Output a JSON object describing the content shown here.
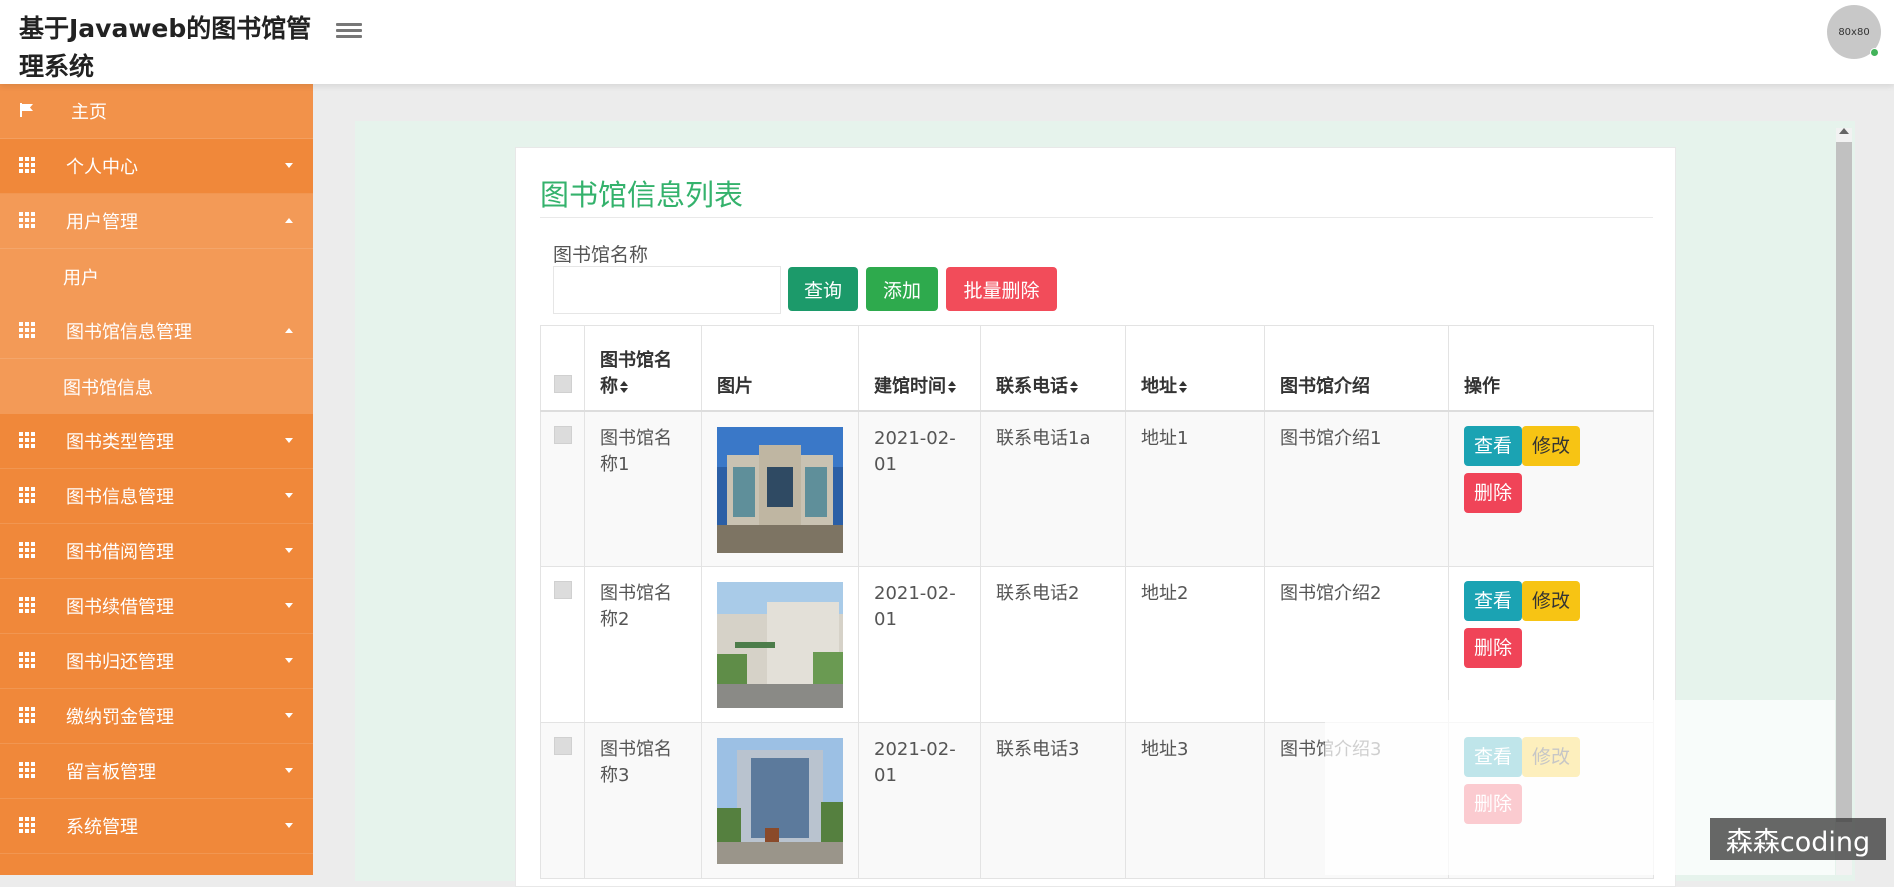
{
  "app": {
    "title": "基于Javaweb的图书馆管理系统",
    "avatar_text": "80x80"
  },
  "sidebar": {
    "items": [
      {
        "label": "主页",
        "icon": "flag-icon"
      },
      {
        "label": "个人中心",
        "icon": "grid-icon"
      },
      {
        "label": "用户管理",
        "icon": "grid-icon",
        "expanded": true,
        "sub": [
          "用户"
        ]
      },
      {
        "label": "图书馆信息管理",
        "icon": "grid-icon",
        "expanded": true,
        "sub": [
          "图书馆信息"
        ]
      },
      {
        "label": "图书类型管理",
        "icon": "grid-icon"
      },
      {
        "label": "图书信息管理",
        "icon": "grid-icon"
      },
      {
        "label": "图书借阅管理",
        "icon": "grid-icon"
      },
      {
        "label": "图书续借管理",
        "icon": "grid-icon"
      },
      {
        "label": "图书归还管理",
        "icon": "grid-icon"
      },
      {
        "label": "缴纳罚金管理",
        "icon": "grid-icon"
      },
      {
        "label": "留言板管理",
        "icon": "grid-icon"
      },
      {
        "label": "系统管理",
        "icon": "grid-icon"
      }
    ]
  },
  "main": {
    "title": "图书馆信息列表",
    "search": {
      "label": "图书馆名称",
      "value": "",
      "placeholder": ""
    },
    "buttons": {
      "query": "查询",
      "add": "添加",
      "batch_delete": "批量删除"
    },
    "table": {
      "headers": [
        "图书馆名称",
        "图片",
        "建馆时间",
        "联系电话",
        "地址",
        "图书馆介绍",
        "操作"
      ],
      "rows": [
        {
          "name": "图书馆名称1",
          "date": "2021-02-01",
          "phone": "联系电话1a",
          "address": "地址1",
          "intro": "图书馆介绍1"
        },
        {
          "name": "图书馆名称2",
          "date": "2021-02-01",
          "phone": "联系电话2",
          "address": "地址2",
          "intro": "图书馆介绍2"
        },
        {
          "name": "图书馆名称3",
          "date": "2021-02-01",
          "phone": "联系电话3",
          "address": "地址3",
          "intro": "图书馆介绍3"
        }
      ],
      "actions": {
        "view": "查看",
        "edit": "修改",
        "delete": "删除"
      }
    }
  },
  "watermark": "森森coding",
  "colors": {
    "sidebar": "#f0883a",
    "title_green": "#34b26c",
    "query": "#1c9a6a",
    "add": "#2eaa4d",
    "batch_delete": "#f24c5a",
    "view": "#1ba3b3",
    "edit": "#f7c414",
    "delete": "#f04458"
  }
}
